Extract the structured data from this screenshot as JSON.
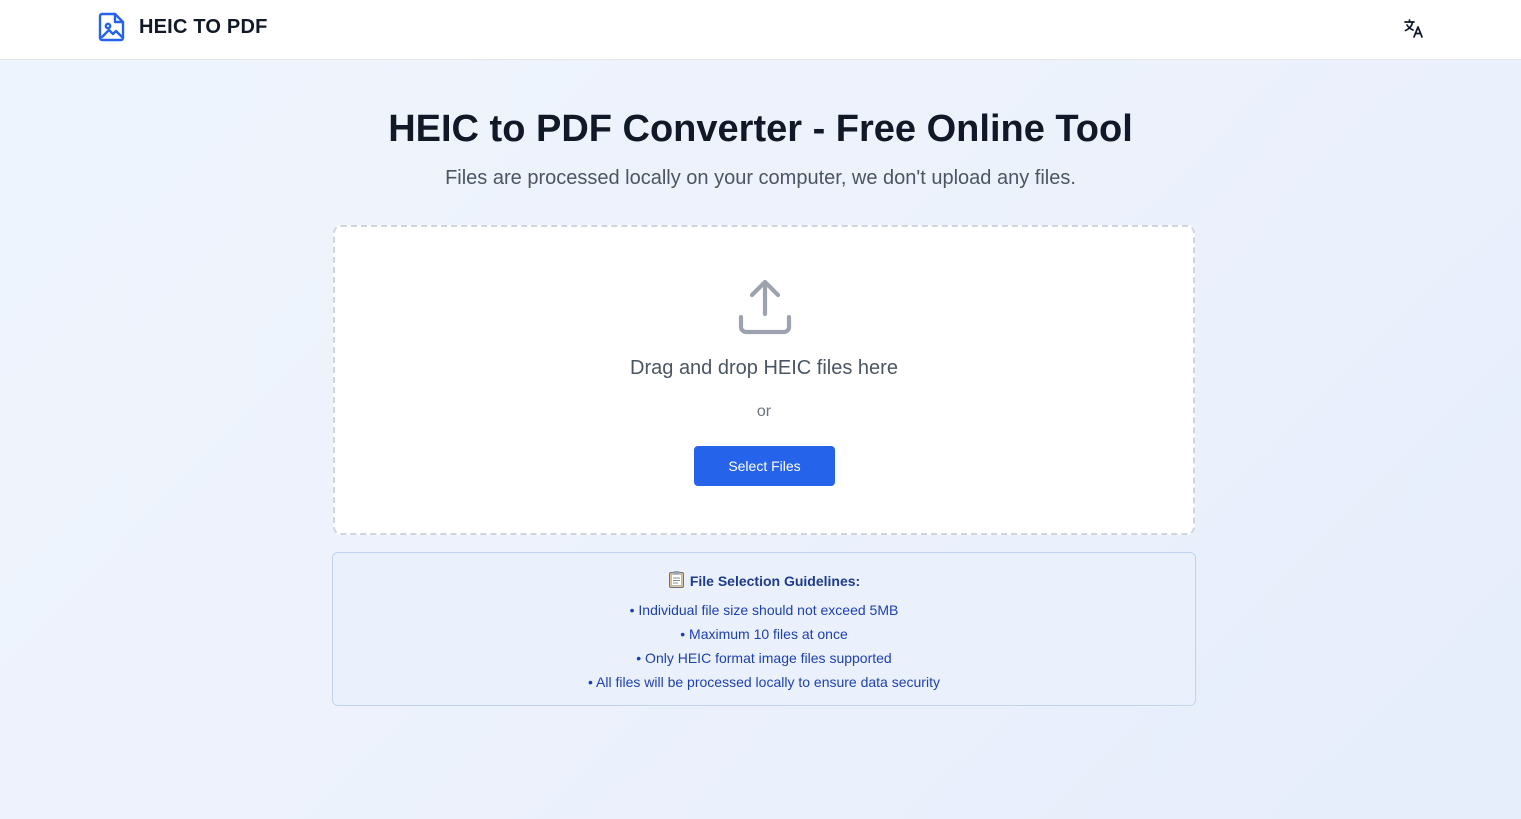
{
  "header": {
    "brand_icon": "file-image-icon",
    "brand_name": "HEIC TO PDF",
    "language_icon": "translate-icon"
  },
  "hero": {
    "title": "HEIC to PDF Converter - Free Online Tool",
    "subtitle": "Files are processed locally on your computer, we don't upload any files."
  },
  "dropzone": {
    "icon": "upload-icon",
    "prompt": "Drag and drop HEIC files here",
    "or_text": "or",
    "button_label": "Select Files"
  },
  "guidelines": {
    "icon": "clipboard-icon",
    "title": "File Selection Guidelines:",
    "items": [
      "• Individual file size should not exceed 5MB",
      "• Maximum 10 files at once",
      "• Only HEIC format image files supported",
      "• All files will be processed locally to ensure data security"
    ]
  },
  "colors": {
    "accent": "#2563eb",
    "guideline_text": "#1e40af",
    "background": "#edf2fc"
  }
}
